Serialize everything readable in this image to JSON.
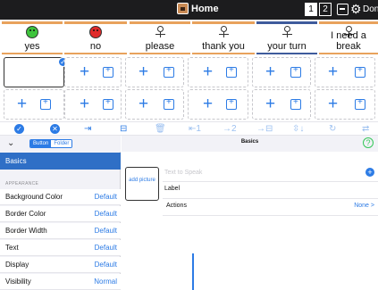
{
  "topbar": {
    "title": "Home",
    "pages": [
      "1",
      "2"
    ],
    "done_label": "Done",
    "icons": [
      "home-icon",
      "keyboard-icon",
      "gear-icon"
    ]
  },
  "core_words": [
    {
      "label": "yes",
      "icon": "happy-face-icon",
      "category": "social",
      "color": "#3ec33c"
    },
    {
      "label": "no",
      "icon": "sad-face-icon",
      "category": "social",
      "color": "#e02a2a"
    },
    {
      "label": "please",
      "icon": "person-please-icon",
      "category": "social"
    },
    {
      "label": "thank you",
      "icon": "person-thank-you-icon",
      "category": "social"
    },
    {
      "label": "your turn",
      "icon": "people-your-turn-icon",
      "category": "person"
    },
    {
      "label": "I need a break",
      "icon": "person-break-icon",
      "category": "verb"
    }
  ],
  "grid": {
    "rows": 2,
    "columns": 6,
    "selected_cell": [
      0,
      0
    ]
  },
  "toolbar": {
    "items": [
      {
        "name": "check-all",
        "icon": "check-circle-icon",
        "label": "✓"
      },
      {
        "name": "clear",
        "icon": "close-circle-icon",
        "label": "✕"
      },
      {
        "name": "import",
        "icon": "import-icon",
        "label": "⇥"
      },
      {
        "name": "edit",
        "icon": "edit-icon",
        "label": "⊟"
      },
      {
        "name": "delete",
        "icon": "trash-icon",
        "label": "🗑"
      },
      {
        "name": "move-left",
        "icon": "move-left-icon",
        "label": "⇤1"
      },
      {
        "name": "move-right",
        "icon": "move-right-icon",
        "label": "→2"
      },
      {
        "name": "move-to-folder",
        "icon": "move-folder-icon",
        "label": "→⊟"
      },
      {
        "name": "sort",
        "icon": "sort-icon",
        "label": "⇳↓"
      },
      {
        "name": "refresh",
        "icon": "refresh-icon",
        "label": "↻"
      },
      {
        "name": "swap",
        "icon": "swap-icon",
        "label": "⇄"
      }
    ]
  },
  "left_panel": {
    "segments": [
      "Button",
      "Folder"
    ],
    "active_segment": "Button",
    "selected_item": "Basics",
    "section": "APPEARANCE",
    "properties": [
      {
        "key": "Background Color",
        "value": "Default"
      },
      {
        "key": "Border Color",
        "value": "Default"
      },
      {
        "key": "Border Width",
        "value": "Default"
      },
      {
        "key": "Text",
        "value": "Default"
      },
      {
        "key": "Display",
        "value": "Default"
      },
      {
        "key": "Visibility",
        "value": "Normal"
      }
    ]
  },
  "right_panel": {
    "title": "Basics",
    "add_picture_label": "add picture",
    "text_to_speak_placeholder": "Text to Speak",
    "label_field": "Label",
    "actions_label": "Actions",
    "actions_value": "None >"
  },
  "colors": {
    "accent": "#2c7be5",
    "selection": "#2f6fc6",
    "social_border": "#e8a25c",
    "person_border": "#3e5b9c",
    "help": "#34c759"
  }
}
